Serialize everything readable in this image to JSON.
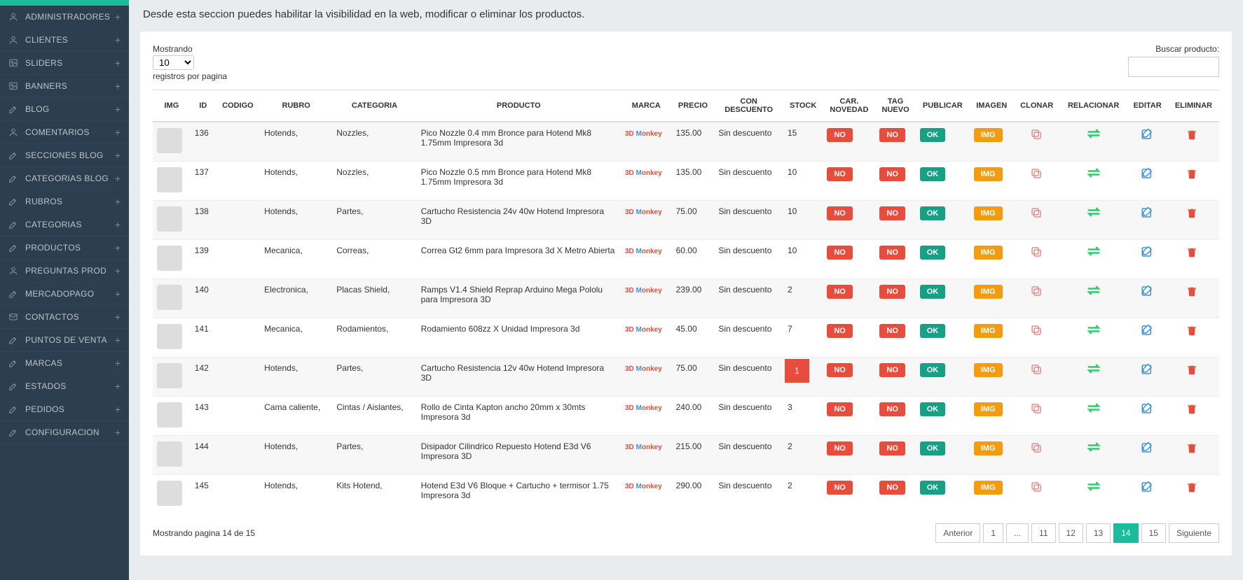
{
  "page_desc": "Desde esta seccion puedes habilitar la visibilidad en la web, modificar o eliminar los productos.",
  "sidebar": [
    {
      "icon": "user",
      "label": "ADMINISTRADORES"
    },
    {
      "icon": "user",
      "label": "CLIENTES"
    },
    {
      "icon": "image",
      "label": "SLIDERS"
    },
    {
      "icon": "image",
      "label": "BANNERS"
    },
    {
      "icon": "edit",
      "label": "BLOG"
    },
    {
      "icon": "user",
      "label": "COMENTARIOS"
    },
    {
      "icon": "edit",
      "label": "SECCIONES BLOG"
    },
    {
      "icon": "edit",
      "label": "CATEGORIAS BLOG"
    },
    {
      "icon": "edit",
      "label": "RUBROS"
    },
    {
      "icon": "edit",
      "label": "CATEGORIAS"
    },
    {
      "icon": "edit",
      "label": "PRODUCTOS"
    },
    {
      "icon": "user",
      "label": "PREGUNTAS PROD"
    },
    {
      "icon": "edit",
      "label": "MERCADOPAGO"
    },
    {
      "icon": "mail",
      "label": "CONTACTOS"
    },
    {
      "icon": "edit",
      "label": "PUNTOS DE VENTA"
    },
    {
      "icon": "edit",
      "label": "MARCAS"
    },
    {
      "icon": "edit",
      "label": "ESTADOS"
    },
    {
      "icon": "edit",
      "label": "PEDIDOS"
    },
    {
      "icon": "edit",
      "label": "CONFIGURACION"
    }
  ],
  "table": {
    "show_label_1": "Mostrando",
    "show_select": "10",
    "show_label_2": "registros por pagina",
    "search_label": "Buscar producto:",
    "headers": [
      "IMG",
      "ID",
      "CODIGO",
      "RUBRO",
      "CATEGORIA",
      "PRODUCTO",
      "MARCA",
      "PRECIO",
      "CON DESCUENTO",
      "STOCK",
      "CAR. NOVEDAD",
      "TAG NUEVO",
      "PUBLICAR",
      "IMAGEN",
      "CLONAR",
      "RELACIONAR",
      "EDITAR",
      "ELIMINAR"
    ],
    "rows": [
      {
        "id": "136",
        "codigo": "",
        "rubro": "Hotends,",
        "categoria": "Nozzles,",
        "producto": "Pico Nozzle 0.4 mm Bronce para Hotend Mk8 1.75mm Impresora 3d",
        "precio": "135.00",
        "descuento": "Sin descuento",
        "stock": "15",
        "stock_low": false
      },
      {
        "id": "137",
        "codigo": "",
        "rubro": "Hotends,",
        "categoria": "Nozzles,",
        "producto": "Pico Nozzle 0.5 mm Bronce para Hotend Mk8 1.75mm Impresora 3d",
        "precio": "135.00",
        "descuento": "Sin descuento",
        "stock": "10",
        "stock_low": false
      },
      {
        "id": "138",
        "codigo": "",
        "rubro": "Hotends,",
        "categoria": "Partes,",
        "producto": "Cartucho Resistencia 24v 40w Hotend Impresora 3D",
        "precio": "75.00",
        "descuento": "Sin descuento",
        "stock": "10",
        "stock_low": false
      },
      {
        "id": "139",
        "codigo": "",
        "rubro": "Mecanica,",
        "categoria": "Correas,",
        "producto": "Correa Gt2 6mm para Impresora 3d X Metro Abierta",
        "precio": "60.00",
        "descuento": "Sin descuento",
        "stock": "10",
        "stock_low": false
      },
      {
        "id": "140",
        "codigo": "",
        "rubro": "Electronica,",
        "categoria": "Placas Shield,",
        "producto": "Ramps V1.4 Shield Reprap Arduino Mega Pololu para Impresora 3D",
        "precio": "239.00",
        "descuento": "Sin descuento",
        "stock": "2",
        "stock_low": false
      },
      {
        "id": "141",
        "codigo": "",
        "rubro": "Mecanica,",
        "categoria": "Rodamientos,",
        "producto": "Rodamiento 608zz X Unidad Impresora 3d",
        "precio": "45.00",
        "descuento": "Sin descuento",
        "stock": "7",
        "stock_low": false
      },
      {
        "id": "142",
        "codigo": "",
        "rubro": "Hotends,",
        "categoria": "Partes,",
        "producto": "Cartucho Resistencia 12v 40w Hotend Impresora 3D",
        "precio": "75.00",
        "descuento": "Sin descuento",
        "stock": "1",
        "stock_low": true
      },
      {
        "id": "143",
        "codigo": "",
        "rubro": "Cama caliente,",
        "categoria": "Cintas / Aislantes,",
        "producto": "Rollo de Cinta Kapton ancho 20mm x 30mts Impresora 3d",
        "precio": "240.00",
        "descuento": "Sin descuento",
        "stock": "3",
        "stock_low": false
      },
      {
        "id": "144",
        "codigo": "",
        "rubro": "Hotends,",
        "categoria": "Partes,",
        "producto": "Disipador Cilindrico Repuesto Hotend E3d V6 Impresora 3D",
        "precio": "215.00",
        "descuento": "Sin descuento",
        "stock": "2",
        "stock_low": false
      },
      {
        "id": "145",
        "codigo": "",
        "rubro": "Hotends,",
        "categoria": "Kits Hotend,",
        "producto": "Hotend E3d V6 Bloque + Cartucho + termisor 1.75 Impresora 3d",
        "precio": "290.00",
        "descuento": "Sin descuento",
        "stock": "2",
        "stock_low": false
      }
    ],
    "btn_no": "NO",
    "btn_ok": "OK",
    "btn_img": "IMG",
    "brand": "3D Monkey",
    "footer_info": "Mostrando pagina 14 de 15",
    "pagination": {
      "prev": "Anterior",
      "pages": [
        "1",
        "...",
        "11",
        "12",
        "13",
        "14",
        "15"
      ],
      "active": "14",
      "next": "Siguiente"
    }
  }
}
